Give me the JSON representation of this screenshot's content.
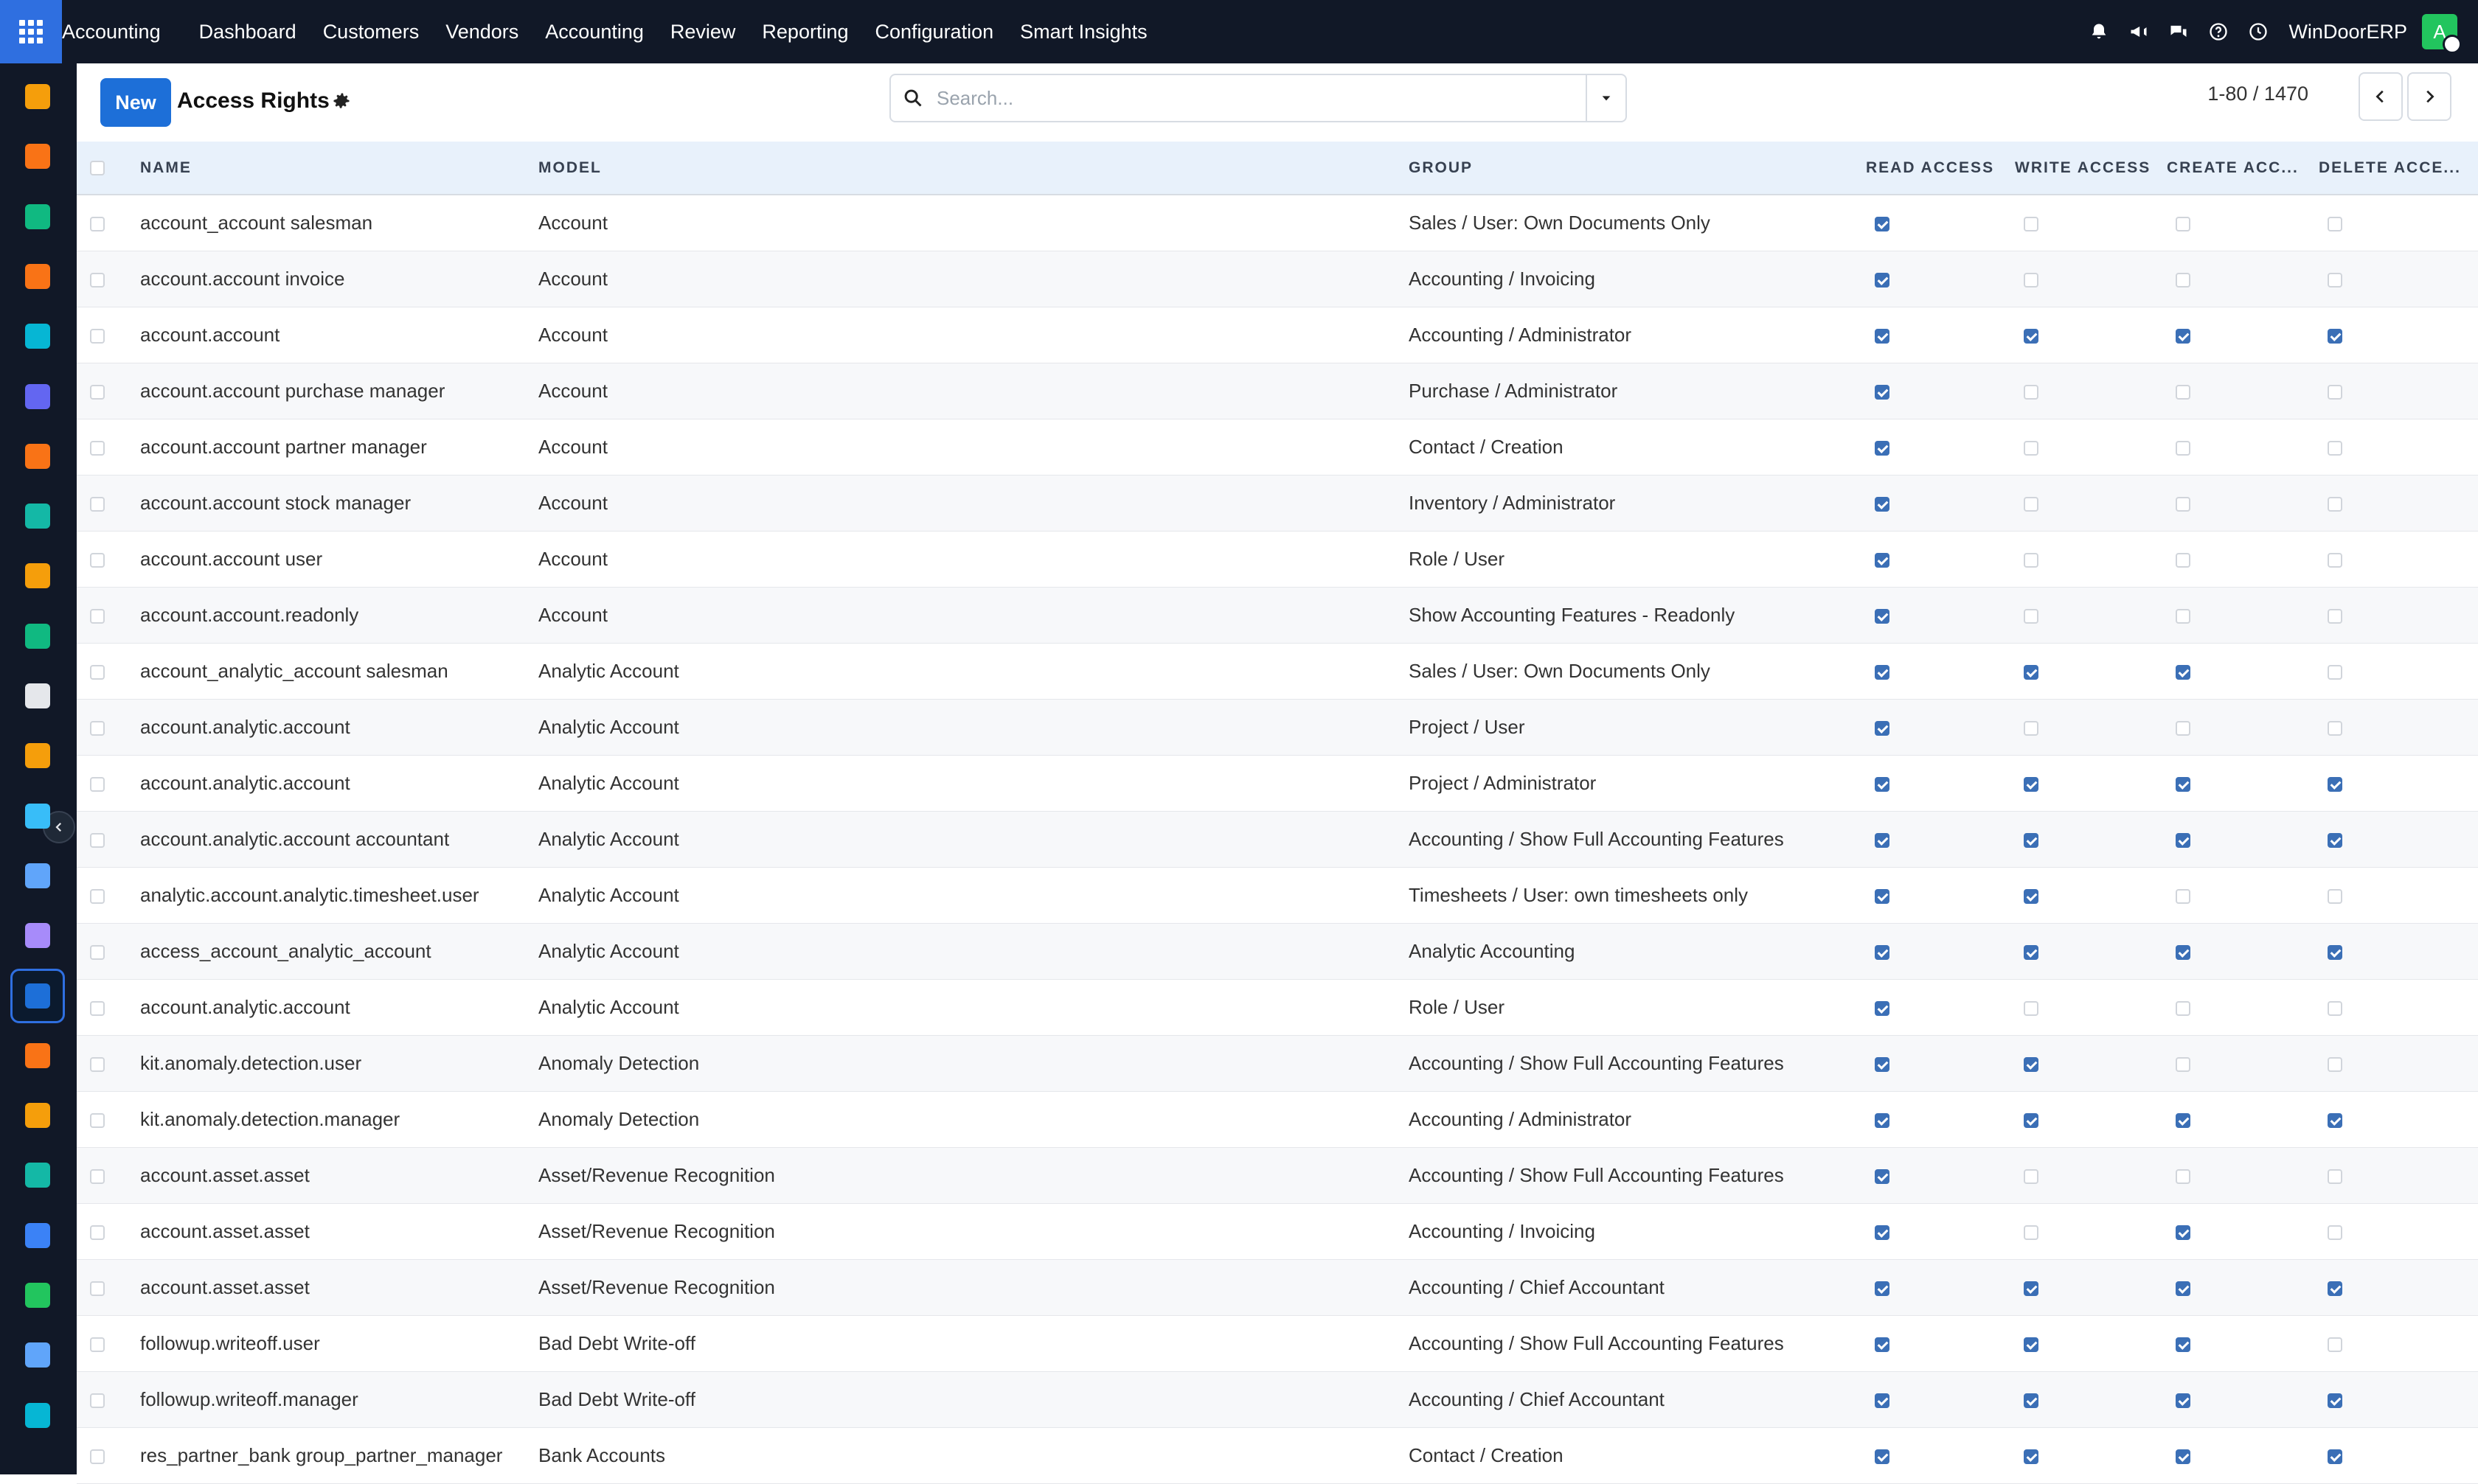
{
  "topbar": {
    "brand": "Accounting",
    "menu": [
      "Dashboard",
      "Customers",
      "Vendors",
      "Accounting",
      "Review",
      "Reporting",
      "Configuration",
      "Smart Insights"
    ],
    "company": "WinDoorERP",
    "avatar_letter": "A"
  },
  "sidebar": {
    "apps": [
      {
        "name": "sales-app-icon",
        "color": "#f59e0b"
      },
      {
        "name": "project-app-icon",
        "color": "#f97316"
      },
      {
        "name": "contacts-app-icon",
        "color": "#10b981"
      },
      {
        "name": "discuss-app-icon",
        "color": "#f97316"
      },
      {
        "name": "website-app-icon",
        "color": "#06b6d4"
      },
      {
        "name": "email-marketing-app-icon",
        "color": "#6366f1"
      },
      {
        "name": "livechat-app-icon",
        "color": "#f97316"
      },
      {
        "name": "helpdesk-app-icon",
        "color": "#14b8a6"
      },
      {
        "name": "reporting-app-icon",
        "color": "#f59e0b"
      },
      {
        "name": "employees-app-icon",
        "color": "#10b981"
      },
      {
        "name": "inventory-app-icon",
        "color": "#e5e7eb"
      },
      {
        "name": "planning-app-icon",
        "color": "#f59e0b"
      },
      {
        "name": "todo-app-icon",
        "color": "#38bdf8"
      },
      {
        "name": "knowledge-app-icon",
        "color": "#60a5fa"
      },
      {
        "name": "barcode-app-icon",
        "color": "#a78bfa"
      },
      {
        "name": "accounting-app-icon",
        "color": "#1d6fd8"
      },
      {
        "name": "team-app-icon",
        "color": "#f97316"
      },
      {
        "name": "calendar-app-icon",
        "color": "#f59e0b"
      },
      {
        "name": "sign-app-icon",
        "color": "#14b8a6"
      },
      {
        "name": "dashboards-app-icon",
        "color": "#3b82f6"
      },
      {
        "name": "whatsapp-app-icon",
        "color": "#22c55e"
      },
      {
        "name": "timesheets-app-icon",
        "color": "#60a5fa"
      },
      {
        "name": "website-builder-app-icon",
        "color": "#06b6d4"
      }
    ]
  },
  "control": {
    "new_label": "New",
    "title": "Access Rights",
    "search_placeholder": "Search...",
    "pager": "1-80 / 1470"
  },
  "table": {
    "headers": {
      "name": "NAME",
      "model": "MODEL",
      "group": "GROUP",
      "read": "READ ACCESS",
      "write": "WRITE ACCESS",
      "create": "CREATE ACC...",
      "delete": "DELETE ACCE..."
    },
    "rows": [
      {
        "name": "account_account salesman",
        "model": "Account",
        "group": "Sales / User: Own Documents Only",
        "read": true,
        "write": false,
        "create": false,
        "delete": false
      },
      {
        "name": "account.account invoice",
        "model": "Account",
        "group": "Accounting / Invoicing",
        "read": true,
        "write": false,
        "create": false,
        "delete": false
      },
      {
        "name": "account.account",
        "model": "Account",
        "group": "Accounting / Administrator",
        "read": true,
        "write": true,
        "create": true,
        "delete": true
      },
      {
        "name": "account.account purchase manager",
        "model": "Account",
        "group": "Purchase / Administrator",
        "read": true,
        "write": false,
        "create": false,
        "delete": false
      },
      {
        "name": "account.account partner manager",
        "model": "Account",
        "group": "Contact / Creation",
        "read": true,
        "write": false,
        "create": false,
        "delete": false
      },
      {
        "name": "account.account stock manager",
        "model": "Account",
        "group": "Inventory / Administrator",
        "read": true,
        "write": false,
        "create": false,
        "delete": false
      },
      {
        "name": "account.account user",
        "model": "Account",
        "group": "Role / User",
        "read": true,
        "write": false,
        "create": false,
        "delete": false
      },
      {
        "name": "account.account.readonly",
        "model": "Account",
        "group": "Show Accounting Features - Readonly",
        "read": true,
        "write": false,
        "create": false,
        "delete": false
      },
      {
        "name": "account_analytic_account salesman",
        "model": "Analytic Account",
        "group": "Sales / User: Own Documents Only",
        "read": true,
        "write": true,
        "create": true,
        "delete": false
      },
      {
        "name": "account.analytic.account",
        "model": "Analytic Account",
        "group": "Project / User",
        "read": true,
        "write": false,
        "create": false,
        "delete": false
      },
      {
        "name": "account.analytic.account",
        "model": "Analytic Account",
        "group": "Project / Administrator",
        "read": true,
        "write": true,
        "create": true,
        "delete": true
      },
      {
        "name": "account.analytic.account accountant",
        "model": "Analytic Account",
        "group": "Accounting / Show Full Accounting Features",
        "read": true,
        "write": true,
        "create": true,
        "delete": true
      },
      {
        "name": "analytic.account.analytic.timesheet.user",
        "model": "Analytic Account",
        "group": "Timesheets / User: own timesheets only",
        "read": true,
        "write": true,
        "create": false,
        "delete": false
      },
      {
        "name": "access_account_analytic_account",
        "model": "Analytic Account",
        "group": "Analytic Accounting",
        "read": true,
        "write": true,
        "create": true,
        "delete": true
      },
      {
        "name": "account.analytic.account",
        "model": "Analytic Account",
        "group": "Role / User",
        "read": true,
        "write": false,
        "create": false,
        "delete": false
      },
      {
        "name": "kit.anomaly.detection.user",
        "model": "Anomaly Detection",
        "group": "Accounting / Show Full Accounting Features",
        "read": true,
        "write": true,
        "create": false,
        "delete": false
      },
      {
        "name": "kit.anomaly.detection.manager",
        "model": "Anomaly Detection",
        "group": "Accounting / Administrator",
        "read": true,
        "write": true,
        "create": true,
        "delete": true
      },
      {
        "name": "account.asset.asset",
        "model": "Asset/Revenue Recognition",
        "group": "Accounting / Show Full Accounting Features",
        "read": true,
        "write": false,
        "create": false,
        "delete": false
      },
      {
        "name": "account.asset.asset",
        "model": "Asset/Revenue Recognition",
        "group": "Accounting / Invoicing",
        "read": true,
        "write": false,
        "create": true,
        "delete": false
      },
      {
        "name": "account.asset.asset",
        "model": "Asset/Revenue Recognition",
        "group": "Accounting / Chief Accountant",
        "read": true,
        "write": true,
        "create": true,
        "delete": true
      },
      {
        "name": "followup.writeoff.user",
        "model": "Bad Debt Write-off",
        "group": "Accounting / Show Full Accounting Features",
        "read": true,
        "write": true,
        "create": true,
        "delete": false
      },
      {
        "name": "followup.writeoff.manager",
        "model": "Bad Debt Write-off",
        "group": "Accounting / Chief Accountant",
        "read": true,
        "write": true,
        "create": true,
        "delete": true
      },
      {
        "name": "res_partner_bank group_partner_manager",
        "model": "Bank Accounts",
        "group": "Contact / Creation",
        "read": true,
        "write": true,
        "create": true,
        "delete": true
      }
    ]
  }
}
